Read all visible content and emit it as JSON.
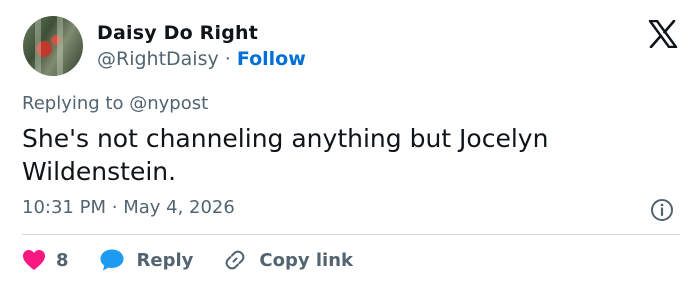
{
  "author": {
    "name": "Daisy Do Right",
    "handle": "@RightDaisy",
    "separator": "·",
    "follow_label": "Follow"
  },
  "tweet": {
    "replying_prefix": "Replying to",
    "replying_to": "@nypost",
    "text": "She's not channeling anything but Jocelyn Wildenstein.",
    "time": "10:31 PM",
    "date_separator": "·",
    "date": "May 4, 2026"
  },
  "actions": {
    "like_count": "8",
    "reply_label": "Reply",
    "copy_link_label": "Copy link"
  },
  "colors": {
    "like": "#f91880",
    "reply": "#1d9bf0",
    "link": "#006fd6",
    "secondary_text": "#536471"
  },
  "icons": [
    "x-logo-icon",
    "info-icon",
    "heart-icon",
    "reply-bubble-icon",
    "link-icon"
  ]
}
